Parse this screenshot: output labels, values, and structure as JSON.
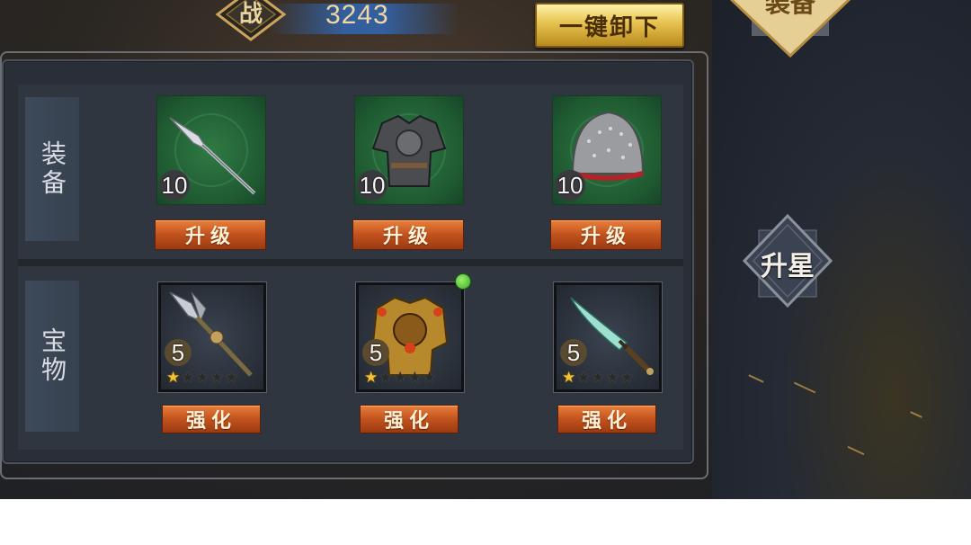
{
  "header": {
    "power_label": "战",
    "power_value": "3243",
    "unequip_all_label": "一键卸下"
  },
  "right_menu": {
    "equip_tab_label": "装备",
    "star_up_label": "升星"
  },
  "sections": {
    "equipment_label": "装备",
    "treasure_label": "宝物"
  },
  "equipment": [
    {
      "item": "spear-icon",
      "level": "10",
      "action": "升级"
    },
    {
      "item": "armor-icon",
      "level": "10",
      "action": "升级"
    },
    {
      "item": "helmet-icon",
      "level": "10",
      "action": "升级"
    }
  ],
  "treasures": [
    {
      "item": "halberd-icon",
      "level": "5",
      "stars": 1,
      "max_stars": 5,
      "action": "强化",
      "notify": false
    },
    {
      "item": "lion-armor-icon",
      "level": "5",
      "stars": 1,
      "max_stars": 5,
      "action": "强化",
      "notify": true
    },
    {
      "item": "dagger-icon",
      "level": "5",
      "stars": 1,
      "max_stars": 5,
      "action": "强化",
      "notify": false
    }
  ],
  "colors": {
    "upgrade_button": "#c2521d",
    "unequip_button": "#e6c24f",
    "equip_slot_bg": "#1f5a31",
    "notify_dot": "#3aa82a",
    "star_on": "#f2c230"
  }
}
